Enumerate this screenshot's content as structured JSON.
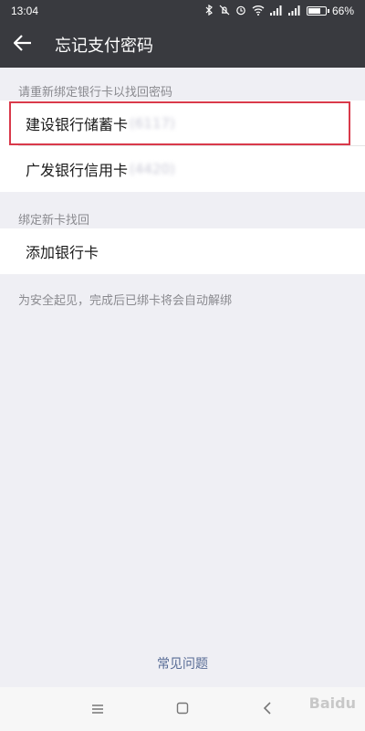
{
  "status_bar": {
    "time": "13:04",
    "battery_text": "66%",
    "battery_level": 0.66
  },
  "header": {
    "title": "忘记支付密码",
    "back_icon": "arrow-left-icon",
    "background": "#393a3f"
  },
  "rebind_section": {
    "label": "请重新绑定银行卡以找回密码",
    "cards": [
      {
        "bank": "建设银行储蓄卡",
        "masked_suffix": "(6117)"
      },
      {
        "bank": "广发银行信用卡",
        "masked_suffix": "(4420)"
      }
    ]
  },
  "new_card_section": {
    "label": "绑定新卡找回",
    "add_label": "添加银行卡"
  },
  "note": "为安全起见，完成后已绑卡将会自动解绑",
  "faq": "常见问题",
  "colors": {
    "link": "#576b95",
    "highlight": "#d9394a"
  },
  "watermark": "Baidu"
}
